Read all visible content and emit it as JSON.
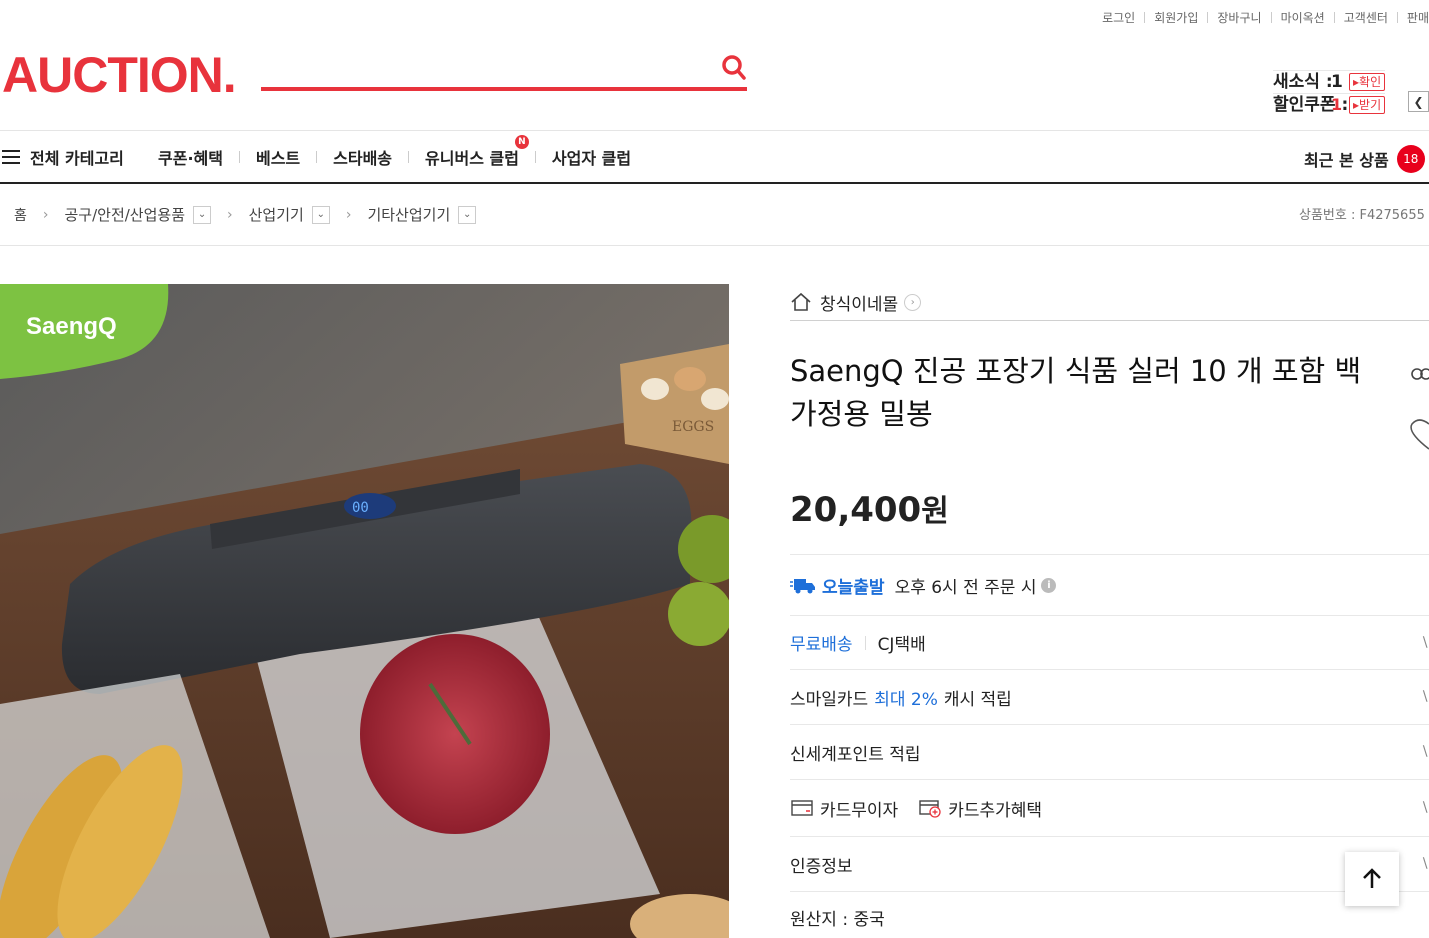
{
  "util_links": [
    "로그인",
    "회원가입",
    "장바구니",
    "마이옥션",
    "고객센터",
    "판매"
  ],
  "header": {
    "logo": "AUCTION.",
    "search_placeholder": "",
    "benefits": {
      "news_label": "새소식 :",
      "news_count": "1",
      "news_action": "▸확인",
      "coupon_label": "할인쿠폰 :",
      "coupon_count": "1",
      "coupon_action": "▸받기"
    }
  },
  "nav": {
    "all_category": "전체 카테고리",
    "items": [
      "쿠폰·혜택",
      "베스트",
      "스타배송",
      "유니버스 클럽",
      "사업자 클럽"
    ],
    "universe_badge": "N",
    "recent_label": "최근 본 상품",
    "recent_count": "18"
  },
  "breadcrumb": {
    "home": "홈",
    "levels": [
      "공구/안전/산업용품",
      "산업기기",
      "기타산업기기"
    ],
    "product_id": "상품번호 : F4275655"
  },
  "product": {
    "image_brand": "SaengQ",
    "image_box_text": "EGGS",
    "shop_name": "창식이네몰",
    "title": "SaengQ 진공 포장기 식품 실러 10 개 포함 백 가정용 밀봉",
    "price": "20,400",
    "price_unit": "원",
    "today_label": "오늘출발",
    "today_desc": "오후 6시 전 주문 시",
    "shipping_free": "무료배송",
    "shipping_carrier": "CJ택배",
    "smile_prefix": "스마일카드",
    "smile_highlight": "최대 2%",
    "smile_suffix": "캐시 적립",
    "shinsegae": "신세계포인트 적립",
    "card_installment": "카드무이자",
    "card_benefit": "카드추가혜택",
    "certification": "인증정보",
    "origin": "원산지 : 중국"
  },
  "colors": {
    "brand_red": "#e8333c",
    "link_blue": "#1e6fd9"
  }
}
